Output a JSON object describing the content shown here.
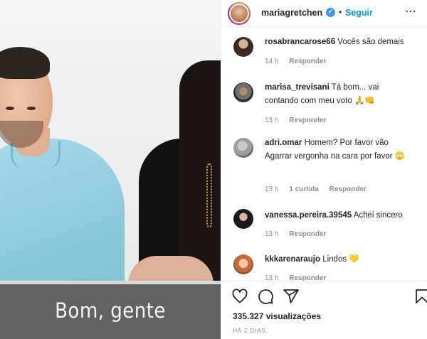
{
  "video": {
    "subtitle": "Bom, gente"
  },
  "header": {
    "username": "mariagretchen",
    "verified_glyph": "✔",
    "separator": "•",
    "follow_label": "Seguir",
    "more_glyph": "⋯"
  },
  "comments": [
    {
      "user": "rosabrancarose66",
      "text": "Vocês são demais",
      "time": "14 h",
      "likes": "",
      "reply": "Responder",
      "emoji": ""
    },
    {
      "user": "marisa_trevisani",
      "text": "Tá bom... vai contando com meu voto",
      "time": "13 h",
      "likes": "",
      "reply": "Responder",
      "emoji": "🙏👊"
    },
    {
      "user": "adri.omar",
      "text": "Homem? Por favor vão Agarrar vergonha na cara por favor",
      "time": "13 h",
      "likes": "1 curtida",
      "reply": "Responder",
      "emoji": "🙄"
    },
    {
      "user": "vanessa.pereira.39545",
      "text": "Achei sincero",
      "time": "13 h",
      "likes": "",
      "reply": "Responder",
      "emoji": ""
    },
    {
      "user": "kkkarenaraujo",
      "text": "Lindos",
      "time": "13 h",
      "likes": "",
      "reply": "Responder",
      "emoji": "💛"
    }
  ],
  "actions": {
    "icons": [
      "heart-icon",
      "comment-icon",
      "share-icon",
      "bookmark-icon"
    ],
    "views": "335.327 visualizações",
    "date": "HÁ 2 DIAS"
  },
  "colors": {
    "accent": "#0095f6",
    "verified": "#3897f0",
    "meta": "#8e8e8e",
    "text": "#262626"
  }
}
